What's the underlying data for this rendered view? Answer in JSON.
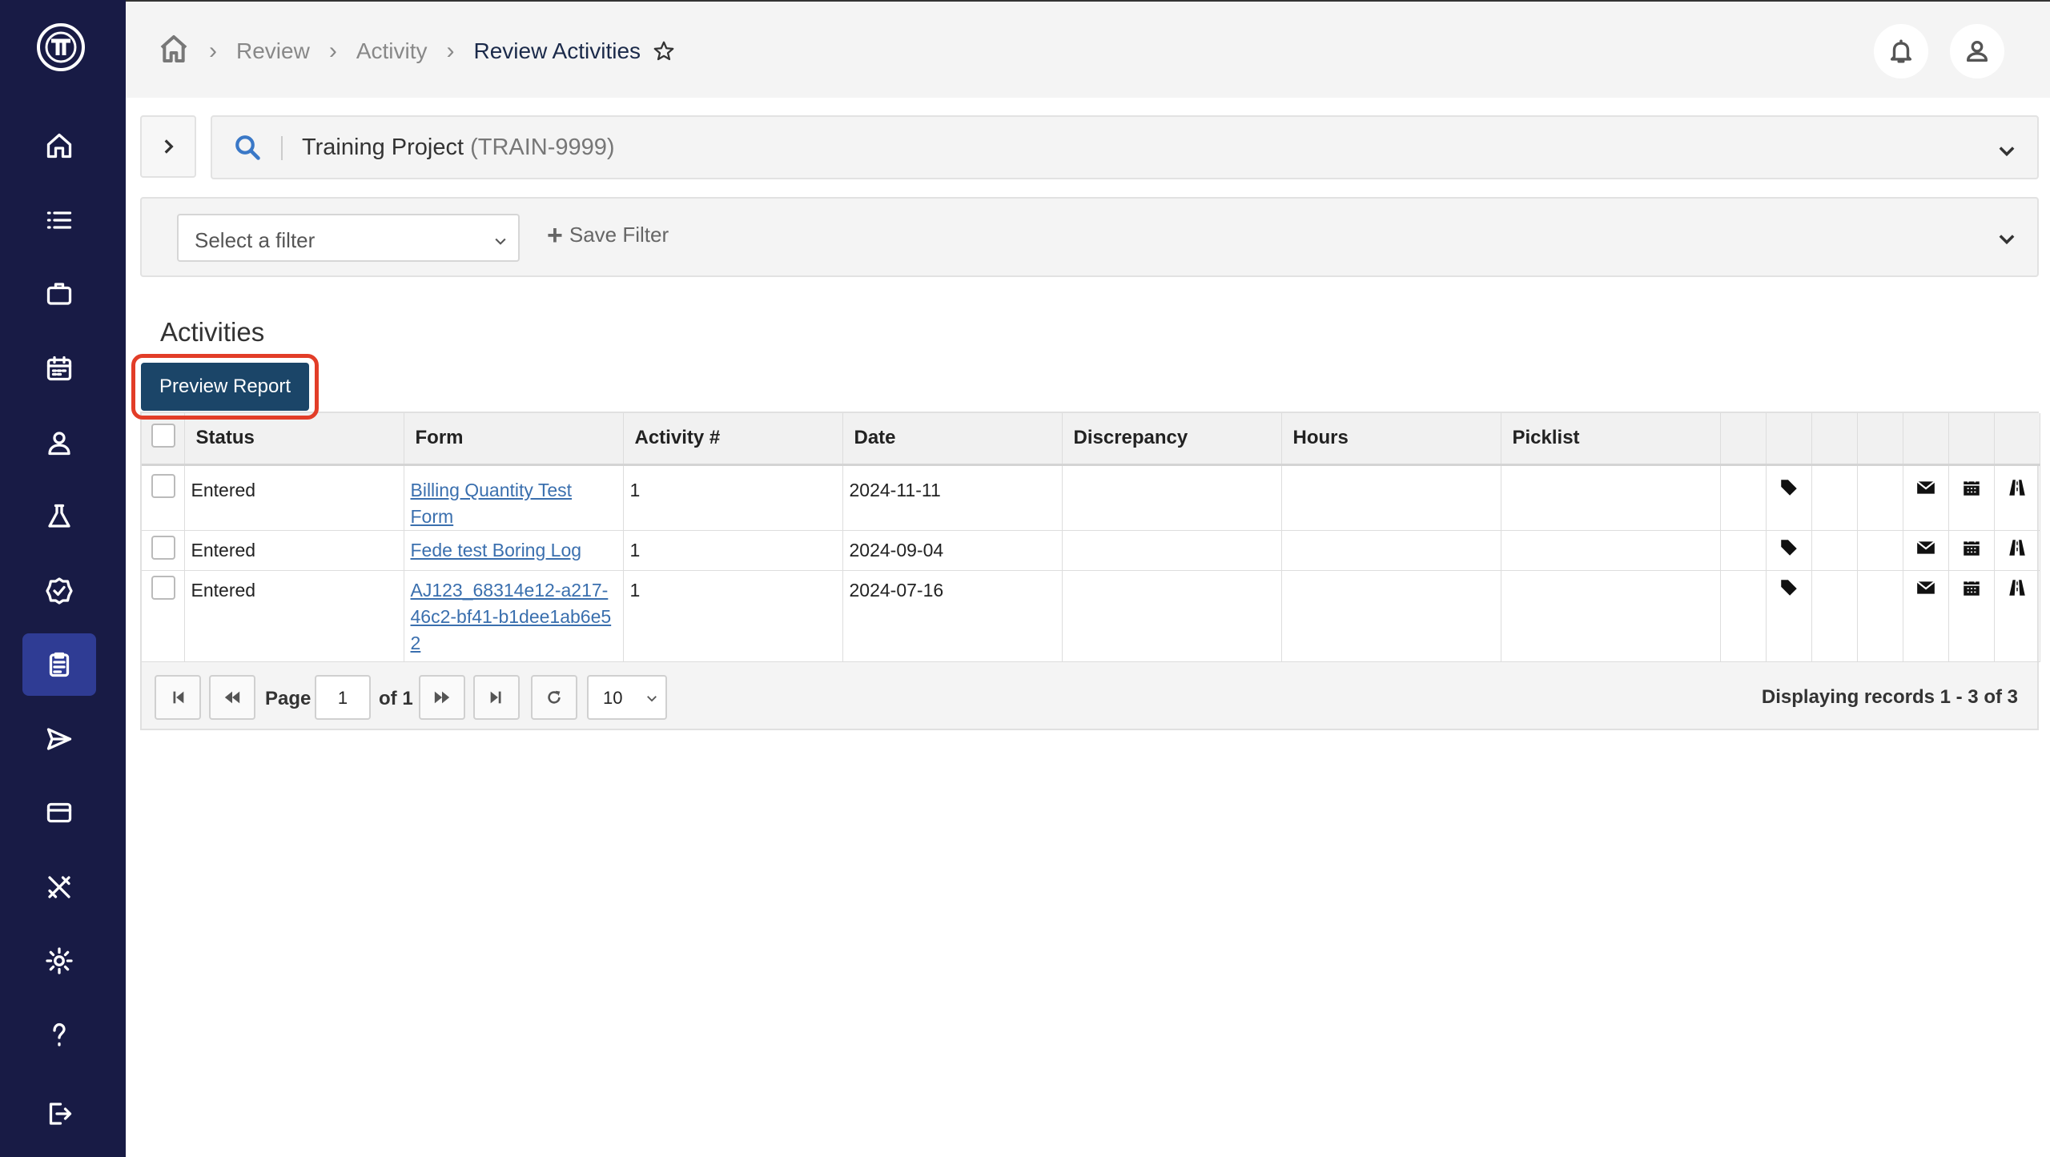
{
  "sidebar": {
    "logo": "logo-icon",
    "items": [
      {
        "name": "home",
        "icon": "home-icon"
      },
      {
        "name": "list",
        "icon": "list-icon"
      },
      {
        "name": "projects",
        "icon": "briefcase-icon"
      },
      {
        "name": "calendar",
        "icon": "calendar-icon"
      },
      {
        "name": "users",
        "icon": "user-icon"
      },
      {
        "name": "lab",
        "icon": "flask-icon"
      },
      {
        "name": "verify",
        "icon": "badge-check-icon"
      },
      {
        "name": "review",
        "icon": "clipboard-icon",
        "active": true
      },
      {
        "name": "send",
        "icon": "send-icon"
      },
      {
        "name": "billing",
        "icon": "card-icon"
      },
      {
        "name": "tools",
        "icon": "tools-icon"
      },
      {
        "name": "settings",
        "icon": "gear-icon"
      },
      {
        "name": "help",
        "icon": "help-icon"
      },
      {
        "name": "logout",
        "icon": "logout-icon"
      }
    ]
  },
  "header": {
    "breadcrumbs": [
      "Review",
      "Activity"
    ],
    "current": "Review Activities"
  },
  "project": {
    "name": "Training Project",
    "code": "(TRAIN-9999)"
  },
  "filter": {
    "placeholder": "Select a filter",
    "save_label": "Save Filter"
  },
  "activities": {
    "title": "Activities",
    "preview_button": "Preview Report",
    "highlight_color": "#e23d28",
    "columns": [
      "Status",
      "Form",
      "Activity #",
      "Date",
      "Discrepancy",
      "Hours",
      "Picklist"
    ],
    "rows": [
      {
        "status": "Entered",
        "form": "Billing Quantity Test Form",
        "activity": "1",
        "date": "2024-11-11",
        "discrepancy": "",
        "hours": "",
        "picklist": ""
      },
      {
        "status": "Entered",
        "form": "Fede test Boring Log",
        "activity": "1",
        "date": "2024-09-04",
        "discrepancy": "",
        "hours": "",
        "picklist": ""
      },
      {
        "status": "Entered",
        "form": "AJ123_68314e12-a217-46c2-bf41-b1dee1ab6e52",
        "activity": "1",
        "date": "2024-07-16",
        "discrepancy": "",
        "hours": "",
        "picklist": ""
      }
    ]
  },
  "pager": {
    "page_label": "Page",
    "page_value": "1",
    "of_label": "of 1",
    "page_size": "10",
    "display_text": "Displaying records  1 - 3  of  3"
  }
}
